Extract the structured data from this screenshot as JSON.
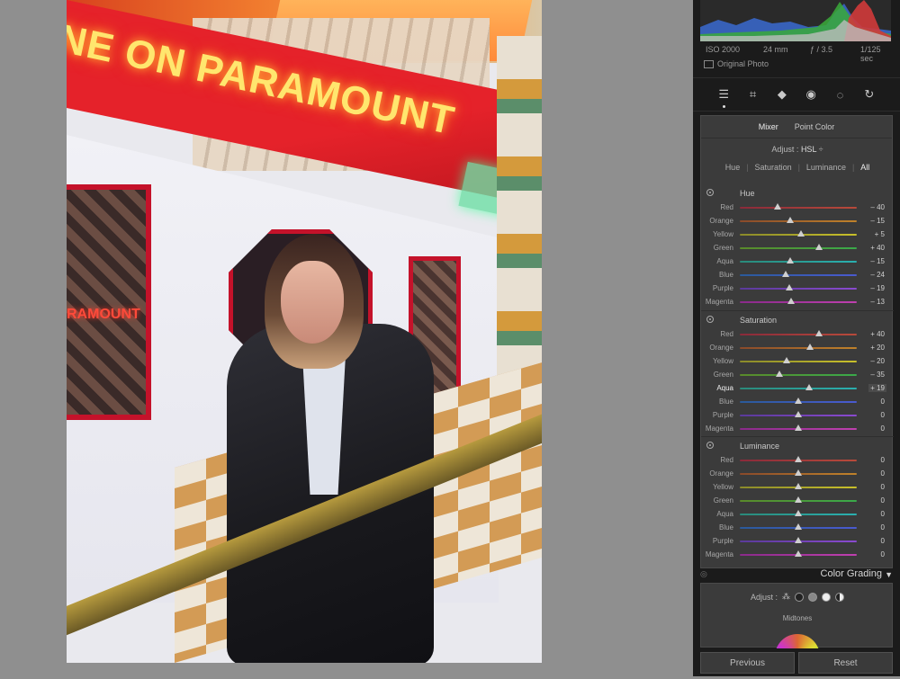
{
  "photo": {
    "sign_text": "NE ON PARAMOUNT",
    "window_text": "RAMOUNT"
  },
  "meta": {
    "iso": "ISO 2000",
    "focal": "24 mm",
    "aperture": "ƒ / 3.5",
    "shutter": "1/125 sec",
    "original_photo": "Original Photo"
  },
  "tools": [
    {
      "name": "edit-sliders-icon",
      "glyph": "☰"
    },
    {
      "name": "crop-icon",
      "glyph": "⌗"
    },
    {
      "name": "healing-eraser-icon",
      "glyph": "◆"
    },
    {
      "name": "redeye-icon",
      "glyph": "◉"
    },
    {
      "name": "masking-icon",
      "glyph": "◌"
    },
    {
      "name": "presets-icon",
      "glyph": "↻"
    }
  ],
  "mixer": {
    "tab_mixer": "Mixer",
    "tab_point_color": "Point Color",
    "adjust_label": "Adjust :",
    "adjust_value": "HSL",
    "adjust_caret": "÷",
    "modes": [
      "Hue",
      "Saturation",
      "Luminance",
      "All"
    ],
    "active_mode": "All"
  },
  "hue": {
    "title": "Hue",
    "rows": [
      {
        "label": "Red",
        "value": "– 40",
        "pos": 0.32
      },
      {
        "label": "Orange",
        "value": "– 15",
        "pos": 0.43
      },
      {
        "label": "Yellow",
        "value": "+ 5",
        "pos": 0.52
      },
      {
        "label": "Green",
        "value": "+ 40",
        "pos": 0.68
      },
      {
        "label": "Aqua",
        "value": "– 15",
        "pos": 0.43
      },
      {
        "label": "Blue",
        "value": "– 24",
        "pos": 0.39
      },
      {
        "label": "Purple",
        "value": "– 19",
        "pos": 0.42
      },
      {
        "label": "Magenta",
        "value": "– 13",
        "pos": 0.44
      }
    ]
  },
  "saturation": {
    "title": "Saturation",
    "rows": [
      {
        "label": "Red",
        "value": "+ 40",
        "pos": 0.68
      },
      {
        "label": "Orange",
        "value": "+ 20",
        "pos": 0.6
      },
      {
        "label": "Yellow",
        "value": "– 20",
        "pos": 0.4
      },
      {
        "label": "Green",
        "value": "– 35",
        "pos": 0.34
      },
      {
        "label": "Aqua",
        "value": "+ 19",
        "pos": 0.59
      },
      {
        "label": "Blue",
        "value": "0",
        "pos": 0.5
      },
      {
        "label": "Purple",
        "value": "0",
        "pos": 0.5
      },
      {
        "label": "Magenta",
        "value": "0",
        "pos": 0.5
      }
    ]
  },
  "luminance": {
    "title": "Luminance",
    "rows": [
      {
        "label": "Red",
        "value": "0",
        "pos": 0.5
      },
      {
        "label": "Orange",
        "value": "0",
        "pos": 0.5
      },
      {
        "label": "Yellow",
        "value": "0",
        "pos": 0.5
      },
      {
        "label": "Green",
        "value": "0",
        "pos": 0.5
      },
      {
        "label": "Aqua",
        "value": "0",
        "pos": 0.5
      },
      {
        "label": "Blue",
        "value": "0",
        "pos": 0.5
      },
      {
        "label": "Purple",
        "value": "0",
        "pos": 0.5
      },
      {
        "label": "Magenta",
        "value": "0",
        "pos": 0.5
      }
    ]
  },
  "track_colors": {
    "Red": [
      "#8a2a3a",
      "#b84a3a"
    ],
    "Orange": [
      "#8a4a2a",
      "#c0822a"
    ],
    "Yellow": [
      "#8a8a2a",
      "#c9c02a"
    ],
    "Green": [
      "#5a8a2a",
      "#3aaa4a"
    ],
    "Aqua": [
      "#2a8a7a",
      "#2ab0b0"
    ],
    "Blue": [
      "#2a5a9a",
      "#4a5ad0"
    ],
    "Purple": [
      "#5a3a9a",
      "#8a4ad0"
    ],
    "Magenta": [
      "#8a2a8a",
      "#c040b0"
    ]
  },
  "color_grading": {
    "title": "Color Grading",
    "adjust_label": "Adjust :",
    "midtones": "Midtones"
  },
  "footer": {
    "previous": "Previous",
    "reset": "Reset"
  }
}
